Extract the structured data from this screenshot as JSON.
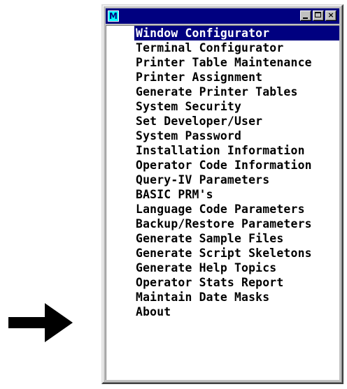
{
  "window": {
    "icon_label": "M",
    "minimize_icon": "minimize-icon",
    "maximize_icon": "maximize-icon",
    "close_label": "×",
    "selected_index": 0
  },
  "menu": {
    "items": [
      {
        "label": "Window Configurator"
      },
      {
        "label": "Terminal Configurator"
      },
      {
        "label": "Printer Table Maintenance"
      },
      {
        "label": "Printer Assignment"
      },
      {
        "label": "Generate Printer Tables"
      },
      {
        "label": "System Security"
      },
      {
        "label": "Set Developer/User"
      },
      {
        "label": "System Password"
      },
      {
        "label": "Installation Information"
      },
      {
        "label": "Operator Code Information"
      },
      {
        "label": "Query-IV Parameters"
      },
      {
        "label": "BASIC PRM's"
      },
      {
        "label": "Language Code Parameters"
      },
      {
        "label": "Backup/Restore Parameters"
      },
      {
        "label": "Generate Sample Files"
      },
      {
        "label": "Generate Script Skeletons"
      },
      {
        "label": "Generate Help Topics"
      },
      {
        "label": "Operator Stats Report"
      },
      {
        "label": "Maintain Date Masks"
      },
      {
        "label": "About"
      }
    ]
  },
  "colors": {
    "titlebar": "#000080",
    "selection": "#000080",
    "frame": "#c0c0c0",
    "pointer": "#000000"
  }
}
